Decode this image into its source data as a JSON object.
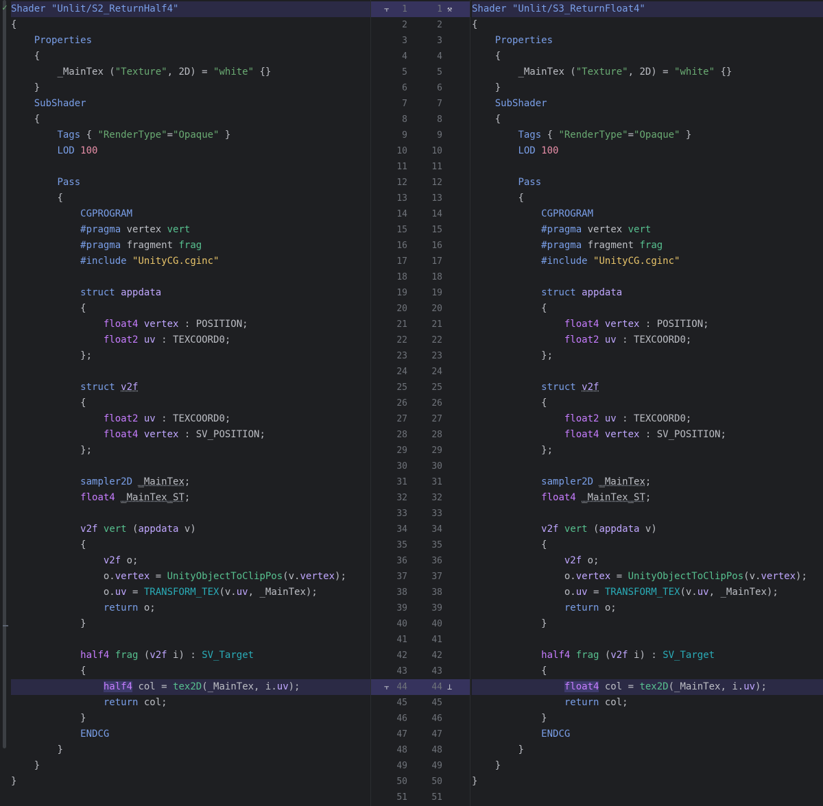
{
  "left_pane": {
    "file_title": "Shader \"Unlit/S2_ReturnHalf4\"",
    "changed_line_type": "half4"
  },
  "right_pane": {
    "file_title": "Shader \"Unlit/S3_ReturnFloat4\"",
    "changed_line_type": "float4"
  },
  "gutter": {
    "line_numbers": [
      "1",
      "2",
      "3",
      "4",
      "5",
      "6",
      "7",
      "8",
      "9",
      "10",
      "11",
      "12",
      "13",
      "14",
      "15",
      "16",
      "17",
      "18",
      "19",
      "20",
      "21",
      "22",
      "23",
      "24",
      "25",
      "26",
      "27",
      "28",
      "29",
      "30",
      "31",
      "32",
      "33",
      "34",
      "35",
      "36",
      "37",
      "38",
      "39",
      "40",
      "41",
      "42",
      "43",
      "44",
      "45",
      "46",
      "47",
      "48",
      "49",
      "50",
      "51"
    ],
    "icons": {
      "left_diff_marker": "diff-arrow-icon",
      "right_build": "hammer-icon",
      "accept_change": "accept-change-icon"
    }
  },
  "code": {
    "l2": "{",
    "l3_kw": "Properties",
    "l4": "{",
    "l5_prop": "_MainTex",
    "l5_open": " (",
    "l5_str": "\"Texture\"",
    "l5_mid": ", 2D) = ",
    "l5_white": "\"white\"",
    "l5_end": " {}",
    "l6": "}",
    "l7_kw": "SubShader",
    "l8": "{",
    "l9_kw": "Tags",
    "l9_a": " { ",
    "l9_s1": "\"RenderType\"",
    "l9_eq": "=",
    "l9_s2": "\"Opaque\"",
    "l9_b": " }",
    "l10_kw": "LOD",
    "l10_num": "100",
    "l12_kw": "Pass",
    "l13": "{",
    "l14": "CGPROGRAM",
    "l15_pr": "#pragma",
    "l15_a": " vertex ",
    "l15_fn": "vert",
    "l16_pr": "#pragma",
    "l16_a": " fragment ",
    "l16_fn": "frag",
    "l17_pr": "#include",
    "l17_s": "\"UnityCG.cginc\"",
    "l19_kw": "struct",
    "l19_name": "appdata",
    "l20": "{",
    "l21_t": "float4",
    "l21_v": "vertex",
    "l21_r": " : POSITION;",
    "l22_t": "float2",
    "l22_v": "uv",
    "l22_r": " : TEXCOORD0;",
    "l23": "};",
    "l25_kw": "struct",
    "l25_name": "v2f",
    "l26": "{",
    "l27_t": "float2",
    "l27_v": "uv",
    "l27_r": " : TEXCOORD0;",
    "l28_t": "float4",
    "l28_v": "vertex",
    "l28_r": " : SV_POSITION;",
    "l29": "};",
    "l31_t": "sampler2D",
    "l31_v": "_MainTex",
    "l31_r": ";",
    "l32_t": "float4",
    "l32_v": "_MainTex_ST",
    "l32_r": ";",
    "l34_t": "v2f",
    "l34_fn": "vert",
    "l34_a": " (",
    "l34_t2": "appdata",
    "l34_b": " v)",
    "l35": "{",
    "l36_t": "v2f",
    "l36_r": " o;",
    "l37_a": "o.",
    "l37_v": "vertex",
    "l37_eq": " = ",
    "l37_fn": "UnityObjectToClipPos",
    "l37_b": "(v.",
    "l37_v2": "vertex",
    "l37_c": ");",
    "l38_a": "o.",
    "l38_v": "uv",
    "l38_eq": " = ",
    "l38_m": "TRANSFORM_TEX",
    "l38_b": "(v.",
    "l38_v2": "uv",
    "l38_c": ", _MainTex);",
    "l39_kw": "return",
    "l39_r": " o;",
    "l40": "}",
    "l42_t": "half4",
    "l42_fn": "frag",
    "l42_a": " (",
    "l42_t2": "v2f",
    "l42_b": " i) : ",
    "l42_sem": "SV_Target",
    "l43": "{",
    "l44_mid": " col = ",
    "l44_fn": "tex2D",
    "l44_r": "(_MainTex, i.",
    "l44_v": "uv",
    "l44_end": ");",
    "l45_kw": "return",
    "l45_r": " col;",
    "l46": "}",
    "l47": "ENDCG",
    "l48": "}",
    "l49": "}",
    "l50": "}"
  },
  "colors": {
    "background": "#1e1f22",
    "highlight": "#2b2a45",
    "keyword": "#7a9fe8",
    "string": "#6aab73",
    "type": "#c77dff"
  }
}
